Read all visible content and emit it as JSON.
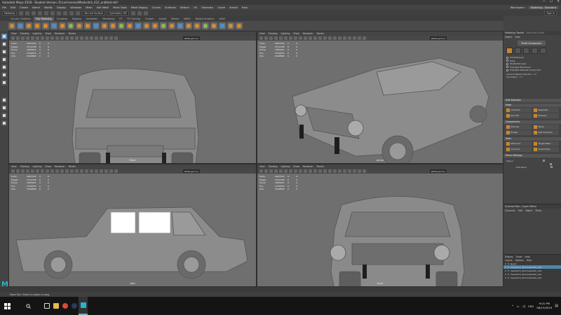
{
  "window": {
    "title": "Autodesk Maya 2018 - Student Version: D:/uni/scenes/Moskvitch_412_untitled.mb*",
    "min": "—",
    "max": "☐",
    "close": "✕"
  },
  "menu": [
    "File",
    "Edit",
    "Create",
    "Select",
    "Modify",
    "Display",
    "Windows",
    "Mesh",
    "Edit Mesh",
    "Mesh Tools",
    "Mesh Display",
    "Curves",
    "Surfaces",
    "Deform",
    "UV",
    "Generate",
    "Cache",
    "Arnold",
    "Help"
  ],
  "workspace": {
    "label": "Workspace :",
    "value": "Modeling - Standard"
  },
  "statusline": {
    "mode": "Modeling",
    "no_live": "No Live Surface",
    "symmetry": "Symmetry: Off",
    "sign_in": "Sign in"
  },
  "shelf_tabs": [
    "Curves / Surfaces",
    "Poly Modeling",
    "Sculpting",
    "Rigging",
    "Animation",
    "Rendering",
    "FX",
    "FX Caching",
    "Custom",
    "Arnold",
    "Bifrost",
    "MASH",
    "Motion Graphics",
    "XGen"
  ],
  "shelf_active": "Poly Modeling",
  "viewport_menu": [
    "View",
    "Shading",
    "Lighting",
    "Show",
    "Renderer",
    "Panels"
  ],
  "hud": {
    "labels": [
      "Verts:",
      "Edges:",
      "Faces:",
      "Tris:",
      "UVs:"
    ],
    "values": [
      "2897156",
      "3714738",
      "1883254",
      "3700576",
      "3949898"
    ],
    "c1": [
      "0",
      "0",
      "0",
      "0",
      "0"
    ],
    "c2": [
      "0",
      "0",
      "0",
      "0",
      "0"
    ]
  },
  "color_space": "sRGB gamma",
  "viewports": [
    {
      "label": "front"
    },
    {
      "label": "persp"
    },
    {
      "label": "side"
    },
    {
      "label": "front"
    }
  ],
  "modeling_toolkit": {
    "title": "Modeling Toolkit",
    "tab2": "Attribute Editor",
    "menu": [
      "Object",
      "Help"
    ],
    "multi": "Multi-Component",
    "options": [
      "Pick/Marquee",
      "Drag",
      "Tweak/Marquee",
      "Highlight Backfaces",
      "Highlight Nearest Component"
    ],
    "camera_based": "Camera Based Selection",
    "camera_based_val": "Off",
    "symmetry": "Symmetry:",
    "symmetry_val": "Off",
    "soft_select": "Soft Selection",
    "sections": {
      "mesh": "Mesh",
      "components": "Components",
      "tools": "Tools",
      "ms": "Mirror Settings"
    },
    "mesh_btns": [
      "Combine",
      "Separate",
      "Smooth",
      "Boolean"
    ],
    "comp_btns": [
      "Extrude",
      "Bevel",
      "Bridge",
      "Add Divisions"
    ],
    "tool_btns": [
      "Multi-Cut",
      "Target Weld",
      "Connect",
      "Quad Draw"
    ],
    "object_lbl": "Object",
    "edit_lbl": "Edit Mesh"
  },
  "channel_box": {
    "title": "Channel Box / Layer Editor",
    "menu": [
      "Channels",
      "Edit",
      "Object",
      "Show"
    ]
  },
  "outliner": {
    "menu": [
      "Display",
      "Show",
      "Help"
    ],
    "sub": [
      "Layers",
      "Options",
      "Help"
    ],
    "rows": [
      "layer1",
      "moskvitch_412:moskvitch_412",
      "moskvitch_412:moskvitch_412",
      "moskvitch_412:moskvitch_412",
      "moskvitch_412:moskvitch_412"
    ]
  },
  "help_line": "Move Tool: Select an object to drag.",
  "mel": "MEL",
  "taskbar": {
    "time": "9:01 PM",
    "date": "06/13/2019",
    "lang": "ENG"
  },
  "colors": {
    "accent": "#5285a6",
    "orange": "#c9862f",
    "maya": "#28b5c8"
  }
}
